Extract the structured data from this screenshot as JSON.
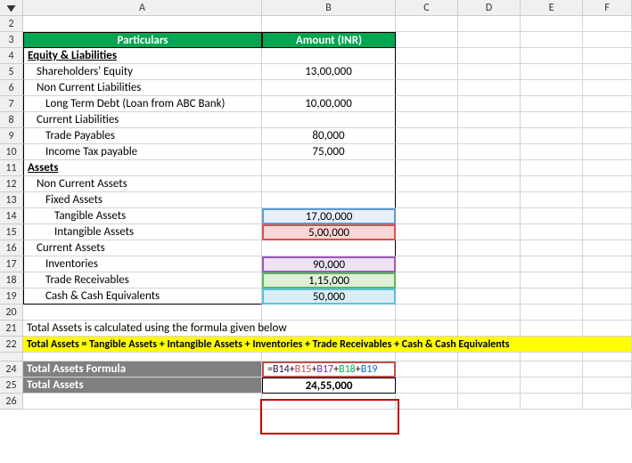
{
  "cols": {
    "A": "A",
    "B": "B",
    "C": "C",
    "D": "D",
    "E": "E",
    "F": "F"
  },
  "rownums": {
    "2": "2",
    "3": "3",
    "4": "4",
    "5": "5",
    "6": "6",
    "7": "7",
    "8": "8",
    "9": "9",
    "10": "10",
    "11": "11",
    "12": "12",
    "13": "13",
    "14": "14",
    "15": "15",
    "16": "16",
    "17": "17",
    "18": "18",
    "19": "19",
    "20": "20",
    "21": "21",
    "22": "22",
    "24": "24",
    "25": "25",
    "26": "26"
  },
  "header": {
    "particulars": "Particulars",
    "amount": "Amount (INR)"
  },
  "rows": {
    "r4": {
      "label": "Equity & Liabilities"
    },
    "r5": {
      "label": "Shareholders' Equity",
      "val": "13,00,000"
    },
    "r6": {
      "label": "Non Current Liabilities"
    },
    "r7": {
      "label": "Long Term Debt (Loan from ABC Bank)",
      "val": "10,00,000"
    },
    "r8": {
      "label": "Current Liabilities"
    },
    "r9": {
      "label": "Trade Payables",
      "val": "80,000"
    },
    "r10": {
      "label": "Income Tax payable",
      "val": "75,000"
    },
    "r11": {
      "label": "Assets"
    },
    "r12": {
      "label": "Non Current Assets"
    },
    "r13": {
      "label": "Fixed Assets"
    },
    "r14": {
      "label": "Tangible Assets",
      "val": "17,00,000"
    },
    "r15": {
      "label": "Intangible Assets",
      "val": "5,00,000"
    },
    "r16": {
      "label": "Current Assets"
    },
    "r17": {
      "label": "Inventories",
      "val": "90,000"
    },
    "r18": {
      "label": "Trade Receivables",
      "val": "1,15,000"
    },
    "r19": {
      "label": "Cash & Cash Equivalents",
      "val": "50,000"
    }
  },
  "note": "Total Assets is calculated using the formula given below",
  "formula_text": "Total Assets = Tangible Assets + Intangible Assets + Inventories + Trade Receivables + Cash & Cash Equivalents",
  "result": {
    "label_formula": "Total Assets Formula",
    "label_total": "Total Assets",
    "value": "24,55,000",
    "formula": {
      "eq": "=",
      "b14": "B14",
      "p": "+",
      "b15": "B15",
      "b17": "B17",
      "b18": "B18",
      "b19": "B19"
    }
  },
  "chart_data": {
    "type": "table",
    "title": "Balance Sheet Summary (INR)",
    "sections": [
      {
        "name": "Equity & Liabilities",
        "items": [
          {
            "label": "Shareholders' Equity",
            "value": 1300000
          },
          {
            "label": "Long Term Debt (Loan from ABC Bank)",
            "value": 1000000,
            "group": "Non Current Liabilities"
          },
          {
            "label": "Trade Payables",
            "value": 80000,
            "group": "Current Liabilities"
          },
          {
            "label": "Income Tax payable",
            "value": 75000,
            "group": "Current Liabilities"
          }
        ]
      },
      {
        "name": "Assets",
        "items": [
          {
            "label": "Tangible Assets",
            "value": 1700000,
            "group": "Non Current Assets / Fixed Assets"
          },
          {
            "label": "Intangible Assets",
            "value": 500000,
            "group": "Non Current Assets / Fixed Assets"
          },
          {
            "label": "Inventories",
            "value": 90000,
            "group": "Current Assets"
          },
          {
            "label": "Trade Receivables",
            "value": 115000,
            "group": "Current Assets"
          },
          {
            "label": "Cash & Cash Equivalents",
            "value": 50000,
            "group": "Current Assets"
          }
        ]
      }
    ],
    "formula": "Total Assets = Tangible Assets + Intangible Assets + Inventories + Trade Receivables + Cash & Cash Equivalents",
    "total_assets": 2455000
  }
}
